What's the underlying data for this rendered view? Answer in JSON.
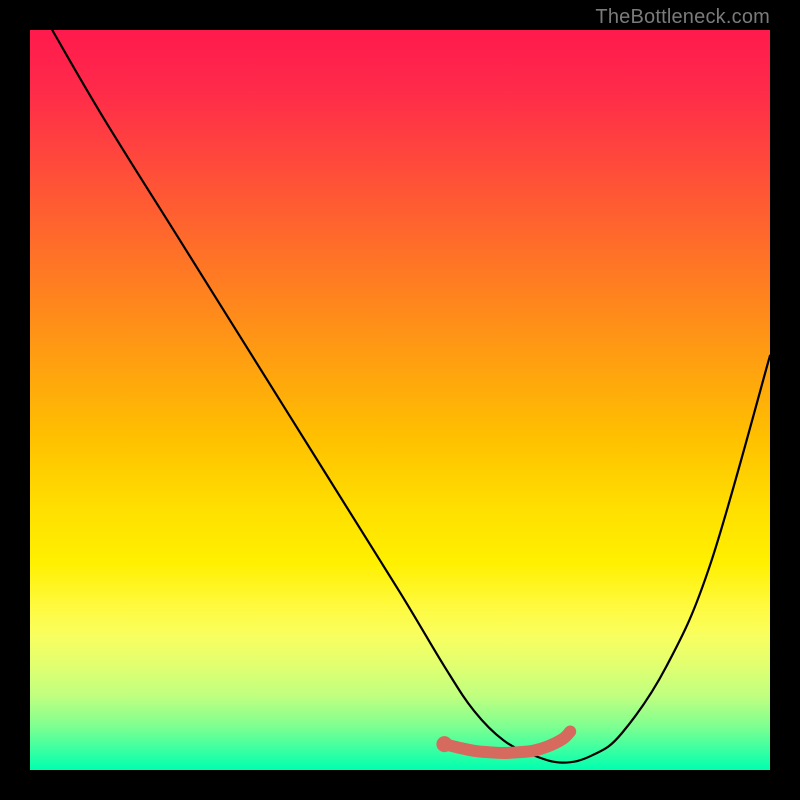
{
  "attribution": "TheBottleneck.com",
  "colors": {
    "background": "#000000",
    "gradient_top": "#ff1a4d",
    "gradient_bottom": "#00ffb0",
    "curve": "#000000",
    "marker": "#d66a5f"
  },
  "chart_data": {
    "type": "line",
    "title": "",
    "xlabel": "",
    "ylabel": "",
    "xlim": [
      0,
      100
    ],
    "ylim": [
      0,
      100
    ],
    "series": [
      {
        "name": "curve",
        "x": [
          3,
          10,
          20,
          30,
          40,
          50,
          56,
          60,
          64,
          68,
          72,
          76,
          80,
          86,
          92,
          100
        ],
        "y": [
          100,
          88,
          72,
          56,
          40,
          24,
          14,
          8,
          4,
          2,
          1,
          2,
          5,
          14,
          28,
          56
        ]
      }
    ],
    "markers": {
      "name": "highlight",
      "x": [
        56,
        58,
        60,
        62,
        64,
        66,
        68,
        70,
        72,
        73
      ],
      "y": [
        3.5,
        3,
        2.6,
        2.4,
        2.3,
        2.4,
        2.6,
        3.2,
        4.2,
        5.2
      ]
    }
  }
}
